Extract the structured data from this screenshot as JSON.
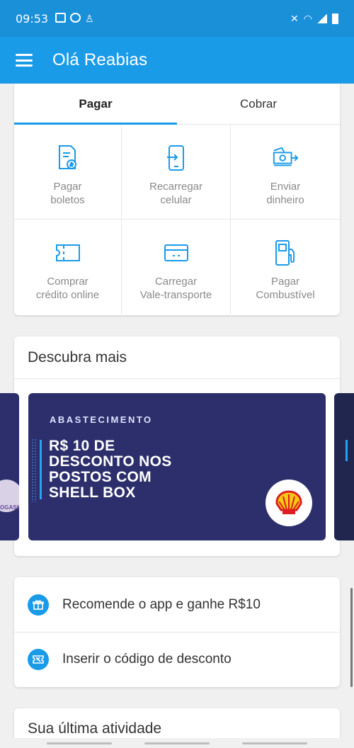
{
  "status_bar": {
    "time": "09:53",
    "left_icons": [
      "image-icon",
      "whatsapp-icon",
      "notification-icon"
    ],
    "right_icons": [
      "mute-icon",
      "wifi-icon",
      "signal-icon",
      "battery-icon"
    ]
  },
  "app_bar": {
    "title": "Olá Reabias",
    "menu_icon": "menu-icon",
    "color": "#1a9be8"
  },
  "pay_card": {
    "tabs": [
      {
        "label": "Pagar",
        "active": true
      },
      {
        "label": "Cobrar",
        "active": false
      }
    ],
    "actions": [
      {
        "label": "Pagar\nboletos",
        "icon": "boleto-icon"
      },
      {
        "label": "Recarregar\ncelular",
        "icon": "phone-recharge-icon"
      },
      {
        "label": "Enviar\ndinheiro",
        "icon": "send-money-icon"
      },
      {
        "label": "Comprar\ncrédito online",
        "icon": "ticket-icon"
      },
      {
        "label": "Carregar\nVale-transporte",
        "icon": "transport-card-icon"
      },
      {
        "label": "Pagar\nCombustível",
        "icon": "fuel-pump-icon"
      }
    ]
  },
  "discover": {
    "title": "Descubra mais",
    "banner": {
      "kicker": "ABASTECIMENTO",
      "headline": "R$ 10 DE\nDESCONTO NOS\nPOSTOS COM\nSHELL BOX",
      "logo": "shell-logo",
      "background": "#2c2f6b"
    },
    "left_peek_text": "OGASIL"
  },
  "actions_list": [
    {
      "label": "Recomende o app e ganhe R$10",
      "icon": "gift-icon"
    },
    {
      "label": "Inserir o código de desconto",
      "icon": "coupon-icon"
    }
  ],
  "last_activity": {
    "title": "Sua última atividade"
  }
}
